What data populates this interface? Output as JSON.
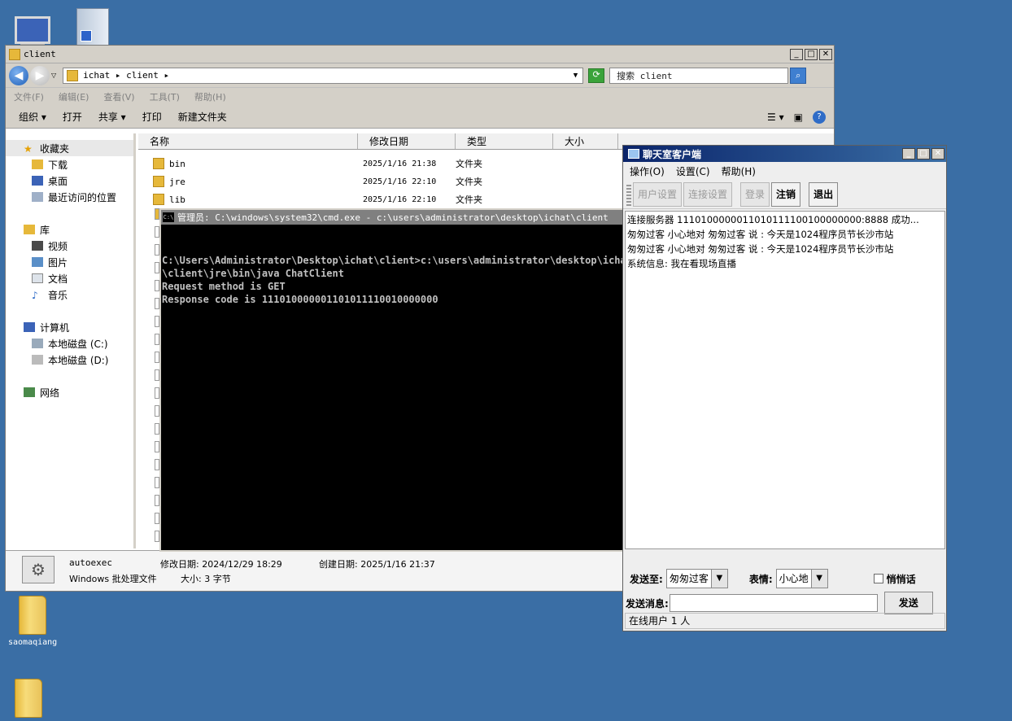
{
  "desktop": {
    "icons": [
      {
        "label": ""
      },
      {
        "label": ""
      },
      {
        "label": "saomaqiang"
      },
      {
        "label": ""
      }
    ]
  },
  "explorer": {
    "title": "client",
    "address_path": "ichat ▸ client ▸",
    "search_placeholder": "搜索 client",
    "menu": [
      "文件(F)",
      "编辑(E)",
      "查看(V)",
      "工具(T)",
      "帮助(H)"
    ],
    "commands": [
      "组织 ▾",
      "打开",
      "共享 ▾",
      "打印",
      "新建文件夹"
    ],
    "nav": {
      "favorites": "收藏夹",
      "downloads": "下载",
      "desktop": "桌面",
      "recent": "最近访问的位置",
      "libraries": "库",
      "videos": "视频",
      "pictures": "图片",
      "documents": "文档",
      "music": "音乐",
      "computer": "计算机",
      "disk_c": "本地磁盘 (C:)",
      "disk_d": "本地磁盘 (D:)",
      "network": "网络"
    },
    "columns": [
      "名称",
      "修改日期",
      "类型",
      "大小"
    ],
    "files": [
      {
        "name": "bin",
        "date": "2025/1/16 21:38",
        "type": "文件夹"
      },
      {
        "name": "jre",
        "date": "2025/1/16 22:10",
        "type": "文件夹"
      },
      {
        "name": "lib",
        "date": "2025/1/16 22:10",
        "type": "文件夹"
      }
    ],
    "details": {
      "name": "autoexec",
      "kind": "Windows 批处理文件",
      "modified": "修改日期: 2024/12/29 18:29",
      "created": "创建日期: 2025/1/16 21:37",
      "size": "大小: 3 字节"
    }
  },
  "cmd": {
    "title": "管理员: C:\\windows\\system32\\cmd.exe - c:\\users\\administrator\\desktop\\ichat\\client",
    "output": "\nC:\\Users\\Administrator\\Desktop\\ichat\\client>c:\\users\\administrator\\desktop\\ichat\n\\client\\jre\\bin\\java ChatClient\nRequest method is GET\nResponse code is 111010000001101011110010000000"
  },
  "chat": {
    "title": "聊天室客户端",
    "menu": [
      "操作(O)",
      "设置(C)",
      "帮助(H)"
    ],
    "toolbar": {
      "user_settings": "用户设置",
      "conn_settings": "连接设置",
      "login": "登录",
      "logout": "注销",
      "exit": "退出"
    },
    "messages": [
      "连接服务器 1110100000011010111100100000000:8888 成功...",
      "匆匆过客 小心地对 匆匆过客 说 : 今天是1024程序员节长沙市站",
      "匆匆过客 小心地对 匆匆过客 说 : 今天是1024程序员节长沙市站",
      "系统信息: 我在看现场直播"
    ],
    "send_to_label": "发送至:",
    "send_to_value": "匆匆过客",
    "expression_label": "表情:",
    "expression_value": "小心地",
    "whisper_label": "悄悄话",
    "message_label": "发送消息:",
    "message_value": "",
    "send_button": "发送",
    "status": "在线用户 1 人"
  }
}
